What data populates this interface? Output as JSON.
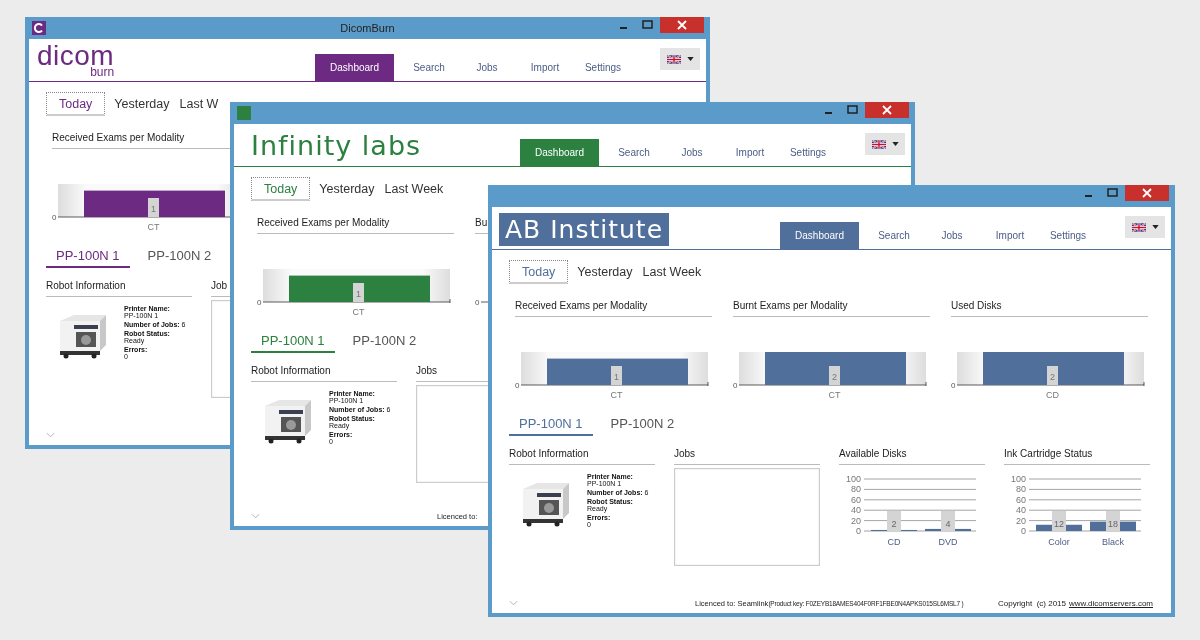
{
  "windows": [
    {
      "title": "DicomBurn",
      "has_icon": true,
      "color": "#6c2a82",
      "logo": {
        "kind": "wordmark",
        "text": "dicom",
        "subtext": "burn"
      },
      "nav": [
        {
          "label": "Dashboard",
          "selected": true
        },
        {
          "label": "Search",
          "selected": false
        },
        {
          "label": "Jobs",
          "selected": false
        },
        {
          "label": "Import",
          "selected": false
        },
        {
          "label": "Settings",
          "selected": false
        }
      ],
      "date_tabs": [
        {
          "label": "Today",
          "selected": true
        },
        {
          "label": "Yesterday",
          "selected": false
        },
        {
          "label": "Last W",
          "selected": false
        }
      ],
      "charts": [
        {
          "title": "Received Exams per Modality",
          "baseline_label": "0",
          "chart_data": {
            "type": "bar",
            "categories": [
              "CT"
            ],
            "values": [
              1
            ],
            "ylim": [
              0,
              1.25
            ],
            "data_labels": true
          }
        }
      ],
      "printer_tabs": [
        {
          "label": "PP-100N 1",
          "selected": true
        },
        {
          "label": "PP-100N 2",
          "selected": false
        }
      ],
      "panels": [
        {
          "kind": "robot",
          "title": "Robot Information",
          "fields": [
            {
              "kind": "stacked",
              "label": "Printer Name:",
              "value": "PP-100N 1"
            },
            {
              "kind": "inline",
              "label": "Number of Jobs:",
              "value": "6"
            },
            {
              "kind": "stacked",
              "label": "Robot Status:",
              "value": "Ready"
            },
            {
              "kind": "stacked",
              "label": "Errors:",
              "value": "0"
            }
          ]
        },
        {
          "kind": "jobs",
          "title": "Job"
        }
      ]
    },
    {
      "has_icon": true,
      "color": "#2c8040",
      "logo": {
        "kind": "plain",
        "text": "Infinity labs"
      },
      "nav": [
        {
          "label": "Dashboard",
          "selected": true
        },
        {
          "label": "Search",
          "selected": false
        },
        {
          "label": "Jobs",
          "selected": false
        },
        {
          "label": "Import",
          "selected": false
        },
        {
          "label": "Settings",
          "selected": false
        }
      ],
      "date_tabs": [
        {
          "label": "Today",
          "selected": true
        },
        {
          "label": "Yesterday",
          "selected": false
        },
        {
          "label": "Last Week",
          "selected": false
        }
      ],
      "charts": [
        {
          "title": "Received Exams per Modality",
          "baseline_label": "0",
          "chart_data": {
            "type": "bar",
            "categories": [
              "CT"
            ],
            "values": [
              1
            ],
            "ylim": [
              0,
              1.25
            ],
            "data_labels": true
          }
        },
        {
          "title": "Bu",
          "baseline_label": "0"
        }
      ],
      "printer_tabs": [
        {
          "label": "PP-100N 1",
          "selected": true
        },
        {
          "label": "PP-100N 2",
          "selected": false
        }
      ],
      "panels": [
        {
          "kind": "robot",
          "title": "Robot Information",
          "fields": [
            {
              "kind": "stacked",
              "label": "Printer Name:",
              "value": "PP-100N 1"
            },
            {
              "kind": "inline",
              "label": "Number of Jobs:",
              "value": "6"
            },
            {
              "kind": "stacked",
              "label": "Robot Status:",
              "value": "Ready"
            },
            {
              "kind": "stacked",
              "label": "Errors:",
              "value": "0"
            }
          ]
        },
        {
          "kind": "jobs",
          "title": "Jobs"
        }
      ],
      "footer": {
        "licence": "Licenced to:"
      }
    },
    {
      "color": "#506f9a",
      "logo": {
        "kind": "boxed",
        "text": "AB Institute"
      },
      "nav": [
        {
          "label": "Dashboard",
          "selected": true
        },
        {
          "label": "Search",
          "selected": false
        },
        {
          "label": "Jobs",
          "selected": false
        },
        {
          "label": "Import",
          "selected": false
        },
        {
          "label": "Settings",
          "selected": false
        }
      ],
      "date_tabs": [
        {
          "label": "Today",
          "selected": true
        },
        {
          "label": "Yesterday",
          "selected": false
        },
        {
          "label": "Last Week",
          "selected": false
        }
      ],
      "charts": [
        {
          "title": "Received Exams per Modality",
          "baseline_label": "0",
          "chart_data": {
            "type": "bar",
            "categories": [
              "CT"
            ],
            "values": [
              1
            ],
            "ylim": [
              0,
              1.25
            ],
            "data_labels": true
          }
        },
        {
          "title": "Burnt Exams per Modality",
          "baseline_label": "0",
          "chart_data": {
            "type": "bar",
            "categories": [
              "CT"
            ],
            "values": [
              2
            ],
            "ylim": [
              0,
              2
            ],
            "data_labels": true
          }
        },
        {
          "title": "Used Disks",
          "baseline_label": "0",
          "chart_data": {
            "type": "bar",
            "categories": [
              "CD"
            ],
            "values": [
              2
            ],
            "ylim": [
              0,
              2
            ],
            "data_labels": true
          }
        }
      ],
      "printer_tabs": [
        {
          "label": "PP-100N 1",
          "selected": true
        },
        {
          "label": "PP-100N 2",
          "selected": false
        }
      ],
      "panels": [
        {
          "kind": "robot",
          "title": "Robot Information",
          "fields": [
            {
              "kind": "stacked",
              "label": "Printer Name:",
              "value": "PP-100N 1"
            },
            {
              "kind": "inline",
              "label": "Number of Jobs:",
              "value": "6"
            },
            {
              "kind": "stacked",
              "label": "Robot Status:",
              "value": "Ready"
            },
            {
              "kind": "stacked",
              "label": "Errors:",
              "value": "0"
            }
          ]
        },
        {
          "kind": "jobs",
          "title": "Jobs"
        },
        {
          "kind": "chart",
          "title": "Available Disks",
          "chart_data": {
            "type": "bar",
            "categories": [
              "CD",
              "DVD"
            ],
            "values": [
              2,
              4
            ],
            "ylim": [
              0,
              100
            ],
            "yticks": [
              0,
              20,
              40,
              60,
              80,
              100
            ],
            "grid": true,
            "data_labels": true
          }
        },
        {
          "kind": "chart",
          "title": "Ink Cartridge Status",
          "chart_data": {
            "type": "bar",
            "categories": [
              "Color",
              "Black"
            ],
            "values": [
              12,
              18
            ],
            "ylim": [
              0,
              100
            ],
            "yticks": [
              0,
              20,
              40,
              60,
              80,
              100
            ],
            "grid": true,
            "data_labels": true
          }
        }
      ],
      "footer": {
        "licence": "Licenced to: Seamlink",
        "product_key": "(Product key: F0ZEYB18AMES404F0RF1FBE0N4APKS015SL6MSL7 )",
        "copyright": "Copyright  (c) 2015",
        "link": "www.dicomservers.com"
      }
    }
  ]
}
